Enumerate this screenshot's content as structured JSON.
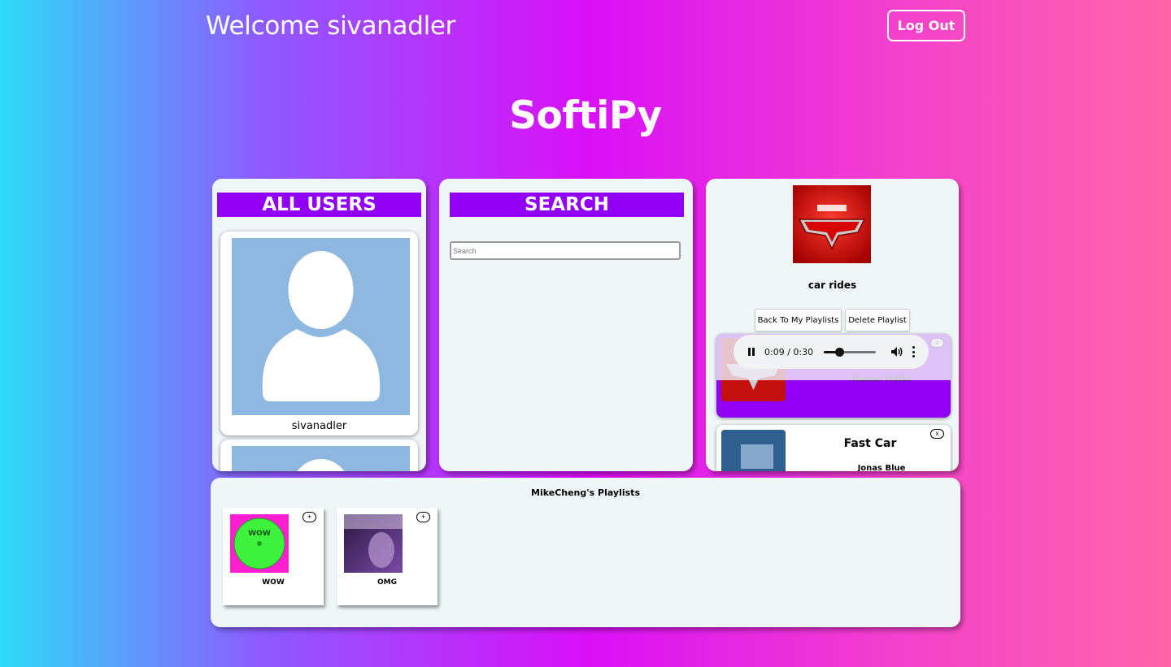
{
  "header": {
    "welcome": "Welcome sivanadler",
    "logout_label": "Log Out",
    "brand": "SoftiPy"
  },
  "users_panel": {
    "title": "ALL USERS",
    "users": [
      {
        "name": "sivanadler"
      },
      {
        "name": ""
      }
    ]
  },
  "search_panel": {
    "title": "SEARCH",
    "placeholder": "Search",
    "value": ""
  },
  "playlist_panel": {
    "playlist_name": "car rides",
    "back_label": "Back To My Playlists",
    "delete_label": "Delete Playlist",
    "remove_label": "x",
    "player": {
      "time": "0:09 / 0:30",
      "progress": 0.3
    },
    "songs": [
      {
        "title": "",
        "artist": "Rascal Flatts"
      },
      {
        "title": "Fast Car",
        "artist": "Jonas Blue"
      }
    ]
  },
  "other_playlists": {
    "title": "MikeCheng's Playlists",
    "add_label": "+",
    "items": [
      {
        "name": "WOW"
      },
      {
        "name": "OMG"
      }
    ]
  },
  "colors": {
    "accent_purple": "#9100f5",
    "panel_bg": "#eff6f7",
    "avatar_bg": "#8fb8e0"
  }
}
